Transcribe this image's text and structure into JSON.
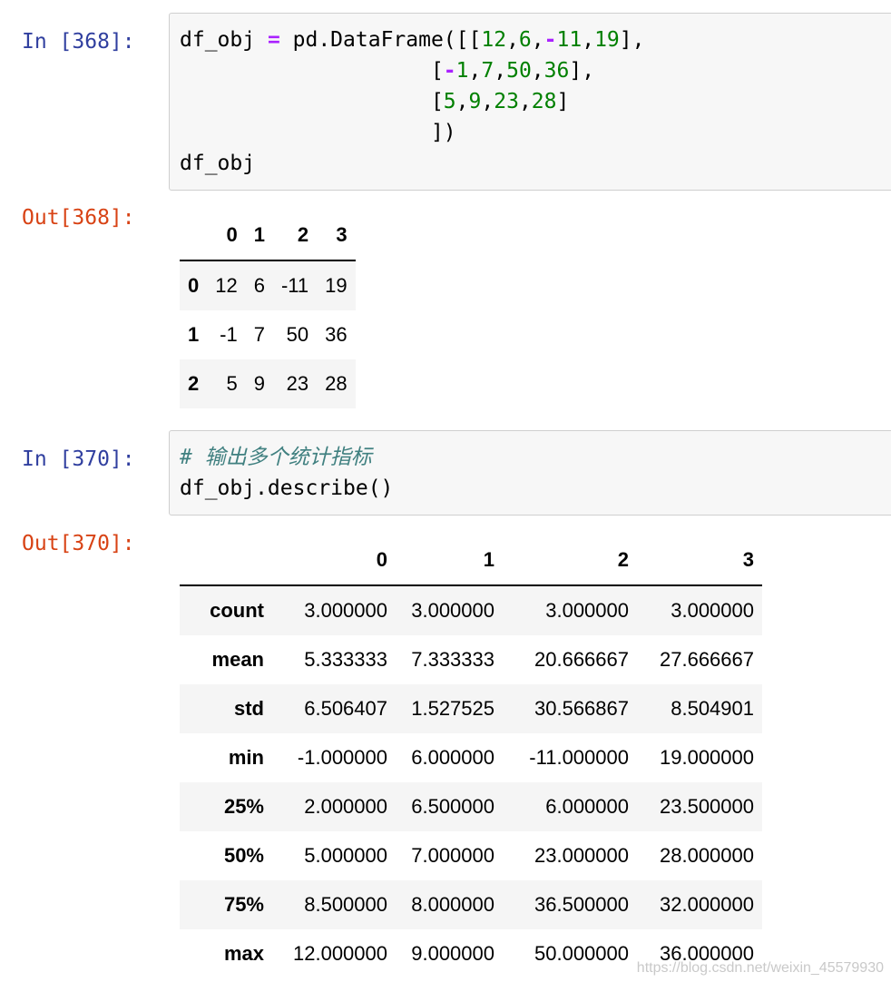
{
  "cell1": {
    "in_prompt": "In [368]:",
    "out_prompt": "Out[368]:",
    "code": {
      "l1_a": "df_obj ",
      "op_eq": "=",
      "l1_b": " pd.DataFrame([[",
      "n1": "12",
      "c1": ",",
      "n2": "6",
      "c2": ",",
      "op_m1": "-",
      "n3": "11",
      "c3": ",",
      "n4": "19",
      "l1_end": "],",
      "l2_pad": "                    [",
      "op_m2": "-",
      "n5": "1",
      "c4": ",",
      "n6": "7",
      "c5": ",",
      "n7": "50",
      "c6": ",",
      "n8": "36",
      "l2_end": "],",
      "l3_pad": "                    [",
      "n9": "5",
      "c7": ",",
      "n10": "9",
      "c8": ",",
      "n11": "23",
      "c9": ",",
      "n12": "28",
      "l3_end": "]",
      "l4": "                    ])",
      "l5": "df_obj"
    },
    "table": {
      "columns": [
        "",
        "0",
        "1",
        "2",
        "3"
      ],
      "rows": [
        {
          "index": "0",
          "values": [
            "12",
            "6",
            "-11",
            "19"
          ]
        },
        {
          "index": "1",
          "values": [
            "-1",
            "7",
            "50",
            "36"
          ]
        },
        {
          "index": "2",
          "values": [
            "5",
            "9",
            "23",
            "28"
          ]
        }
      ]
    }
  },
  "cell2": {
    "in_prompt": "In [370]:",
    "out_prompt": "Out[370]:",
    "code": {
      "comment": "# 输出多个统计指标",
      "line2": "df_obj.describe()"
    },
    "table": {
      "columns": [
        "",
        "0",
        "1",
        "2",
        "3"
      ],
      "rows": [
        {
          "index": "count",
          "values": [
            "3.000000",
            "3.000000",
            "3.000000",
            "3.000000"
          ]
        },
        {
          "index": "mean",
          "values": [
            "5.333333",
            "7.333333",
            "20.666667",
            "27.666667"
          ]
        },
        {
          "index": "std",
          "values": [
            "6.506407",
            "1.527525",
            "30.566867",
            "8.504901"
          ]
        },
        {
          "index": "min",
          "values": [
            "-1.000000",
            "6.000000",
            "-11.000000",
            "19.000000"
          ]
        },
        {
          "index": "25%",
          "values": [
            "2.000000",
            "6.500000",
            "6.000000",
            "23.500000"
          ]
        },
        {
          "index": "50%",
          "values": [
            "5.000000",
            "7.000000",
            "23.000000",
            "28.000000"
          ]
        },
        {
          "index": "75%",
          "values": [
            "8.500000",
            "8.000000",
            "36.500000",
            "32.000000"
          ]
        },
        {
          "index": "max",
          "values": [
            "12.000000",
            "9.000000",
            "50.000000",
            "36.000000"
          ]
        }
      ]
    }
  },
  "watermark": "https://blog.csdn.net/weixin_45579930"
}
